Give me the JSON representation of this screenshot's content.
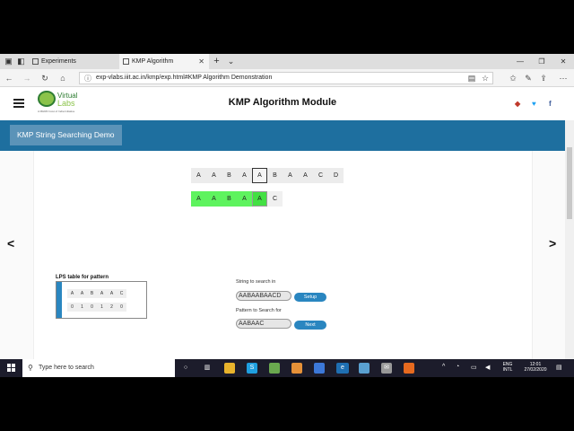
{
  "browser": {
    "tabs": [
      {
        "label": "Experiments",
        "active": false
      },
      {
        "label": "KMP Algorithm",
        "active": true
      }
    ],
    "new_tab": "+",
    "url": "exp-vlabs.iiit.ac.in/kmp/exp.html#KMP Algorithm Demonstration"
  },
  "header": {
    "logo_line1": "Virtual",
    "logo_line2": "Labs",
    "logo_tagline": "A MHRD Govt of India Initiative",
    "title": "KMP Algorithm Module"
  },
  "banner": {
    "label": "KMP String Searching Demo"
  },
  "nav": {
    "prev": "<",
    "next": ">"
  },
  "text_row": [
    "A",
    "A",
    "B",
    "A",
    "A",
    "B",
    "A",
    "A",
    "C",
    "D"
  ],
  "text_current_index": 4,
  "pattern_row": [
    "A",
    "A",
    "B",
    "A",
    "A",
    "C"
  ],
  "pattern_current_index": 4,
  "lps": {
    "title": "LPS table for pattern",
    "pattern": [
      "A",
      "A",
      "B",
      "A",
      "A",
      "C"
    ],
    "values": [
      "0",
      "1",
      "0",
      "1",
      "2",
      "0"
    ]
  },
  "form": {
    "string_label": "String to search in",
    "string_value": "AABAABAACD",
    "setup_label": "Setup",
    "pattern_label": "Pattern to Search for",
    "pattern_value": "AABAAC",
    "next_label": "Next"
  },
  "taskbar": {
    "search_placeholder": "Type here to search",
    "lang": "ENG",
    "lang2": "INTL",
    "time": "12:01",
    "date": "27/02/2020"
  },
  "colors": {
    "banner": "#1e6f9f",
    "match": "#5ef35e",
    "button": "#2a86c0"
  }
}
